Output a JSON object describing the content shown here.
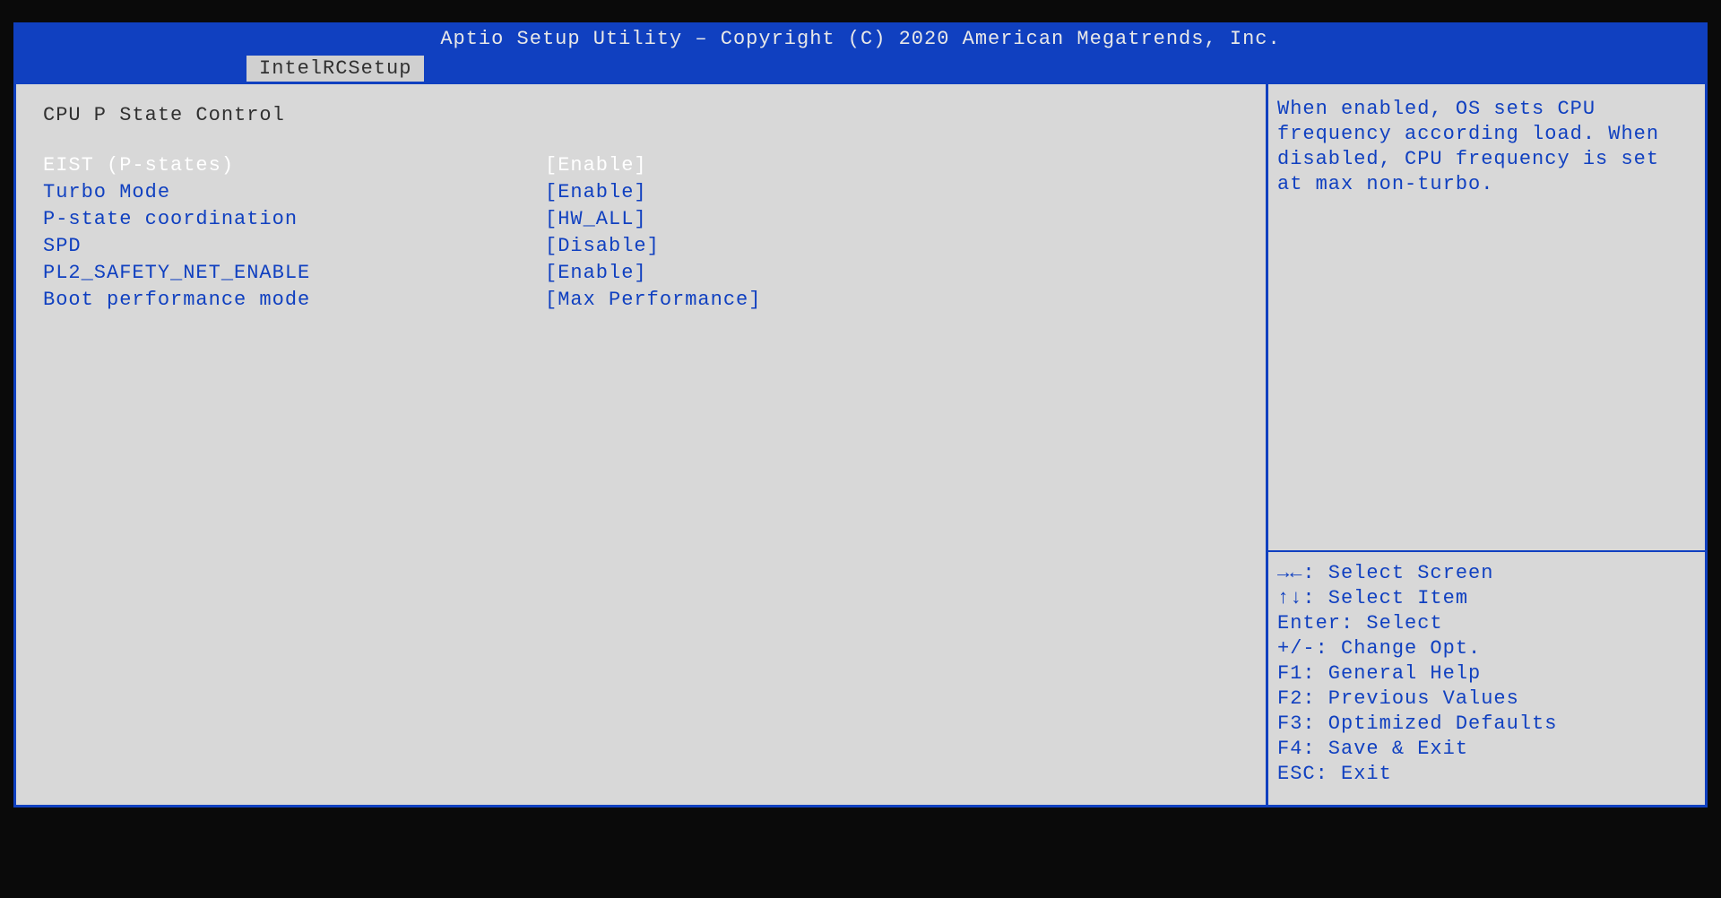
{
  "header": {
    "title": "Aptio Setup Utility – Copyright (C) 2020 American Megatrends, Inc.",
    "tab": "IntelRCSetup"
  },
  "section": {
    "title": "CPU P State Control"
  },
  "settings": [
    {
      "label": "EIST (P-states)",
      "value": "[Enable]",
      "selected": true
    },
    {
      "label": "Turbo Mode",
      "value": "[Enable]",
      "selected": false
    },
    {
      "label": "P-state coordination",
      "value": "[HW_ALL]",
      "selected": false
    },
    {
      "label": "SPD",
      "value": "[Disable]",
      "selected": false
    },
    {
      "label": "PL2_SAFETY_NET_ENABLE",
      "value": "[Enable]",
      "selected": false
    },
    {
      "label": "Boot performance mode",
      "value": "[Max Performance]",
      "selected": false
    }
  ],
  "help_text": "When enabled, OS sets CPU frequency according load. When disabled, CPU frequency is set at max non-turbo.",
  "key_help": [
    "→←: Select Screen",
    "↑↓: Select Item",
    "Enter: Select",
    "+/-: Change Opt.",
    "F1: General Help",
    "F2: Previous Values",
    "F3: Optimized Defaults",
    "F4: Save & Exit",
    "ESC: Exit"
  ]
}
